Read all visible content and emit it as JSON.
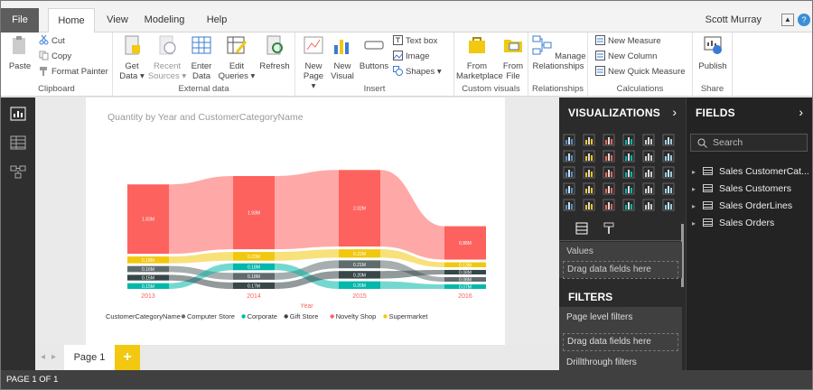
{
  "menubar": {
    "tabs": [
      "File",
      "Home",
      "View",
      "Modeling",
      "Help"
    ],
    "user": "Scott Murray",
    "help": "?"
  },
  "ribbon": {
    "clipboard": {
      "label": "Clipboard",
      "paste": "Paste",
      "cut": "Cut",
      "copy": "Copy",
      "format_painter": "Format Painter"
    },
    "external": {
      "label": "External data",
      "get_data": "Get Data ▾",
      "recent_sources": "Recent Sources ▾",
      "enter_data": "Enter Data",
      "edit_queries": "Edit Queries ▾",
      "refresh": "Refresh"
    },
    "insert": {
      "label": "Insert",
      "new_page": "New Page ▾",
      "new_visual": "New Visual",
      "buttons": "Buttons",
      "text_box": "Text box",
      "image": "Image",
      "shapes": "Shapes ▾"
    },
    "custom": {
      "label": "Custom visuals",
      "from_marketplace": "From Marketplace",
      "from_file": "From File"
    },
    "relationships": {
      "label": "Relationships",
      "manage": "Manage Relationships"
    },
    "calculations": {
      "label": "Calculations",
      "new_measure": "New Measure",
      "new_column": "New Column",
      "new_quick_measure": "New Quick Measure"
    },
    "share": {
      "label": "Share",
      "publish": "Publish"
    }
  },
  "report": {
    "title": "Quantity by Year and CustomerCategoryName"
  },
  "chart_data": {
    "type": "area",
    "title": "Quantity by Year and CustomerCategoryName",
    "xlabel": "Year",
    "categories": [
      "2013",
      "2014",
      "2015",
      "2016"
    ],
    "legend_title": "CustomerCategoryName",
    "series": [
      {
        "name": "Computer Store",
        "color": "#5f6b6d",
        "labels": [
          "0.16M",
          "0.18M",
          "0.21M",
          "0.08M"
        ],
        "values": [
          0.16,
          0.18,
          0.21,
          0.08
        ]
      },
      {
        "name": "Corporate",
        "color": "#01b8aa",
        "labels": [
          "0.15M",
          "0.18M",
          "0.20M",
          "0.07M"
        ],
        "values": [
          0.15,
          0.18,
          0.2,
          0.07
        ]
      },
      {
        "name": "Gift Store",
        "color": "#374649",
        "labels": [
          "0.15M",
          "0.17M",
          "0.20M",
          "0.08M"
        ],
        "values": [
          0.15,
          0.17,
          0.2,
          0.08
        ]
      },
      {
        "name": "Novelty Shop",
        "color": "#fd625e",
        "labels": [
          "1.83M",
          "1.93M",
          "2.02M",
          "0.88M"
        ],
        "values": [
          1.83,
          1.93,
          2.02,
          0.88
        ]
      },
      {
        "name": "Supermarket",
        "color": "#f2c80f",
        "labels": [
          "0.18M",
          "0.23M",
          "0.22M",
          "0.13M"
        ],
        "values": [
          0.18,
          0.23,
          0.22,
          0.13
        ]
      }
    ]
  },
  "pages": {
    "tab": "Page 1",
    "add": "+",
    "prev": "◂",
    "next": "▸"
  },
  "status": "PAGE 1 OF 1",
  "viz": {
    "header": "VISUALIZATIONS",
    "chevron": "›",
    "values": "Values",
    "drag": "Drag data fields here"
  },
  "filters": {
    "header": "FILTERS",
    "page_level": "Page level filters",
    "drag": "Drag data fields here",
    "drillthrough": "Drillthrough filters"
  },
  "fields": {
    "header": "FIELDS",
    "chevron": "›",
    "search_placeholder": "Search",
    "tables": [
      "Sales CustomerCat...",
      "Sales Customers",
      "Sales OrderLines",
      "Sales Orders"
    ]
  }
}
